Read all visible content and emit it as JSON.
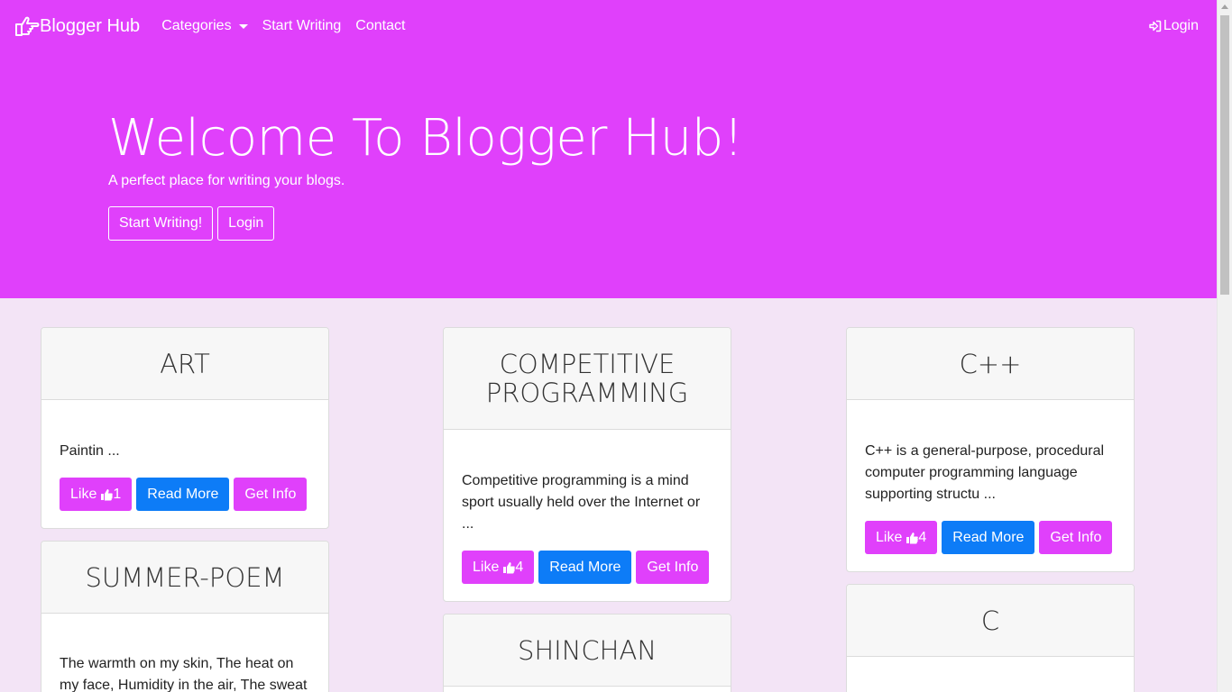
{
  "nav": {
    "brand": "Blogger Hub",
    "categories": "Categories",
    "start_writing": "Start Writing",
    "contact": "Contact",
    "login": "Login"
  },
  "hero": {
    "title": "Welcome To Blogger Hub!",
    "subtitle": "A perfect place for writing your blogs.",
    "start_btn": "Start Writing!",
    "login_btn": "Login"
  },
  "buttons": {
    "read_more": "Read More",
    "get_info": "Get Info",
    "like": "Like"
  },
  "cards": [
    {
      "title": "ART",
      "text": "Paintin ...",
      "likes": "1"
    },
    {
      "title": "SUMMER-POEM",
      "text": "The warmth on my skin, The heat on my face, Humidity in the air, The sweat"
    },
    {
      "title": "COMPETITIVE PROGRAMMING",
      "text": "Competitive programming is a mind sport usually held over the Internet or ...",
      "likes": "4"
    },
    {
      "title": "SHINCHAN"
    },
    {
      "title": "C++",
      "text": "C++ is a general-purpose, procedural computer programming language supporting structu ...",
      "likes": "4"
    },
    {
      "title": "C"
    }
  ],
  "colors": {
    "brand": "#e040fb",
    "primary": "#0d7cf7",
    "background": "#f3e4f6"
  }
}
